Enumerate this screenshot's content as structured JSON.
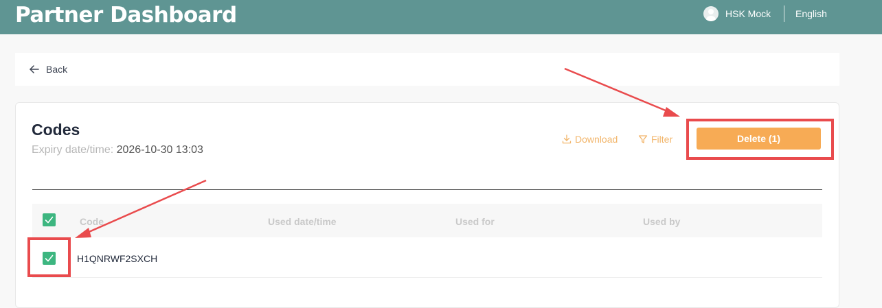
{
  "header": {
    "title": "Partner Dashboard",
    "user_name": "HSK Mock",
    "language": "English",
    "bg_color": "#5f9593"
  },
  "nav": {
    "back_label": "Back"
  },
  "codes": {
    "title": "Codes",
    "expiry_label": "Expiry date/time:",
    "expiry_value": "2026-10-30 13:03",
    "download_label": "Download",
    "filter_label": "Filter",
    "delete_label": "Delete (1)",
    "accent_color": "#f7ab55",
    "check_color": "#3db680",
    "columns": [
      "Code",
      "Used date/time",
      "Used for",
      "Used by"
    ],
    "rows": [
      {
        "code": "H1QNRWF2SXCH",
        "used_datetime": "",
        "used_for": "",
        "used_by": "",
        "checked": true
      }
    ],
    "select_all_checked": true
  },
  "annotations": {
    "color": "#e94b4d"
  }
}
